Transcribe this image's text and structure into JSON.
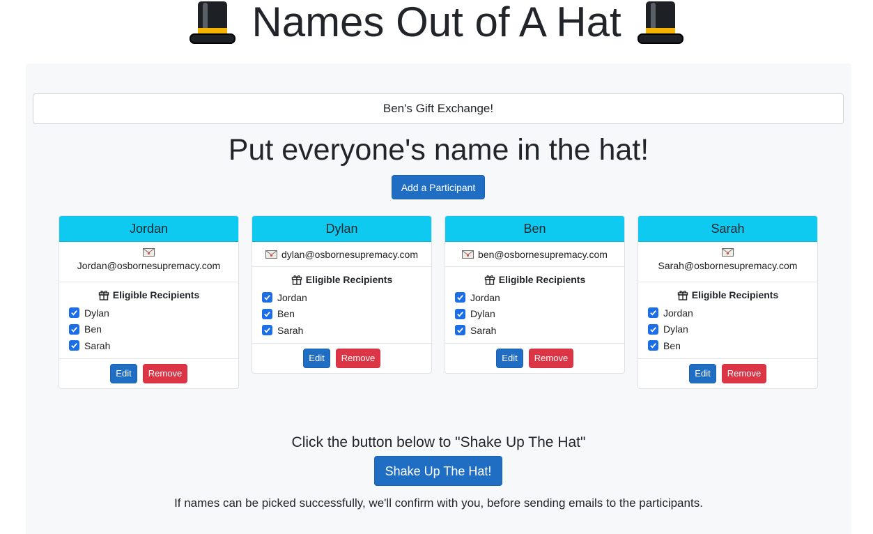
{
  "app": {
    "title": "Names Out of A Hat",
    "title_icon": "top-hat-icon"
  },
  "event": {
    "name": "Ben's Gift Exchange!"
  },
  "main": {
    "heading": "Put everyone's name in the hat!",
    "add_button_label": "Add a Participant"
  },
  "participants": [
    {
      "name": "Jordan",
      "email": "Jordan@osbornesupremacy.com",
      "recipients_label": "Eligible Recipients",
      "recipients": [
        {
          "name": "Dylan",
          "checked": true
        },
        {
          "name": "Ben",
          "checked": true
        },
        {
          "name": "Sarah",
          "checked": true
        }
      ],
      "edit_label": "Edit",
      "remove_label": "Remove"
    },
    {
      "name": "Dylan",
      "email": "dylan@osbornesupremacy.com",
      "recipients_label": "Eligible Recipients",
      "recipients": [
        {
          "name": "Jordan",
          "checked": true
        },
        {
          "name": "Ben",
          "checked": true
        },
        {
          "name": "Sarah",
          "checked": true
        }
      ],
      "edit_label": "Edit",
      "remove_label": "Remove"
    },
    {
      "name": "Ben",
      "email": "ben@osbornesupremacy.com",
      "recipients_label": "Eligible Recipients",
      "recipients": [
        {
          "name": "Jordan",
          "checked": true
        },
        {
          "name": "Dylan",
          "checked": true
        },
        {
          "name": "Sarah",
          "checked": true
        }
      ],
      "edit_label": "Edit",
      "remove_label": "Remove"
    },
    {
      "name": "Sarah",
      "email": "Sarah@osbornesupremacy.com",
      "recipients_label": "Eligible Recipients",
      "recipients": [
        {
          "name": "Jordan",
          "checked": true
        },
        {
          "name": "Dylan",
          "checked": true
        },
        {
          "name": "Ben",
          "checked": true
        }
      ],
      "edit_label": "Edit",
      "remove_label": "Remove"
    }
  ],
  "shake": {
    "instruction": "Click the button below to \"Shake Up The Hat\"",
    "button_label": "Shake Up The Hat!",
    "note": "If names can be picked successfully, we'll confirm with you, before sending emails to the participants."
  },
  "colors": {
    "card_header": "#0fcaf0",
    "primary": "#1f6ec4",
    "danger": "#dc3545",
    "checkbox": "#1c6ee8",
    "panel_bg": "#f7f8fa"
  }
}
